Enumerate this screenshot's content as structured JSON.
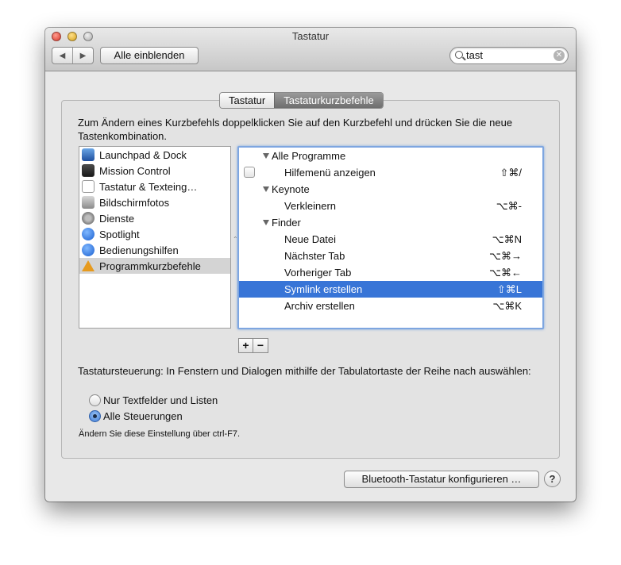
{
  "window": {
    "title": "Tastatur"
  },
  "toolbar": {
    "back_icon": "◀",
    "forward_icon": "▶",
    "show_all": "Alle einblenden",
    "search_value": "tast",
    "clear_icon": "✕"
  },
  "tabs": [
    {
      "label": "Tastatur",
      "active": false
    },
    {
      "label": "Tastaturkurzbefehle",
      "active": true
    }
  ],
  "intro": "Zum Ändern eines Kurzbefehls doppelklicken Sie auf den Kurzbefehl und drücken Sie die neue Tastenkombination.",
  "categories": [
    {
      "label": "Launchpad & Dock",
      "icon": "launchpad-icon"
    },
    {
      "label": "Mission Control",
      "icon": "mission-control-icon"
    },
    {
      "label": "Tastatur & Texteing…",
      "icon": "keyboard-icon"
    },
    {
      "label": "Bildschirmfotos",
      "icon": "screenshot-icon"
    },
    {
      "label": "Dienste",
      "icon": "services-gear-icon"
    },
    {
      "label": "Spotlight",
      "icon": "spotlight-icon"
    },
    {
      "label": "Bedienungshilfen",
      "icon": "accessibility-icon"
    },
    {
      "label": "Programmkurzbefehle",
      "icon": "app-shortcuts-icon",
      "selected": true
    }
  ],
  "shortcuts": [
    {
      "type": "group",
      "label": "Alle Programme"
    },
    {
      "type": "item",
      "label": "Hilfemenü anzeigen",
      "key": "⇧⌘/",
      "checkbox": true
    },
    {
      "type": "group",
      "label": "Keynote"
    },
    {
      "type": "item",
      "label": "Verkleinern",
      "key": "⌥⌘-"
    },
    {
      "type": "group",
      "label": "Finder"
    },
    {
      "type": "item",
      "label": "Neue Datei",
      "key": "⌥⌘N"
    },
    {
      "type": "item",
      "label": "Nächster Tab",
      "key": "⌥⌘→"
    },
    {
      "type": "item",
      "label": "Vorheriger Tab",
      "key": "⌥⌘←"
    },
    {
      "type": "item",
      "label": "Symlink erstellen",
      "key": "⇧⌘L",
      "selected": true
    },
    {
      "type": "item",
      "label": "Archiv erstellen",
      "key": "⌥⌘K"
    }
  ],
  "buttons": {
    "add": "+",
    "remove": "−"
  },
  "keyboard_control": {
    "text": "Tastatursteuerung: In Fenstern und Dialogen mithilfe der Tabulatortaste der Reihe nach auswählen:",
    "option_text_fields": "Nur Textfelder und Listen",
    "option_all_controls": "Alle Steuerungen",
    "selected": "Alle Steuerungen",
    "hint": "Ändern Sie diese Einstellung über ctrl-F7."
  },
  "footer": {
    "bluetooth": "Bluetooth-Tastatur konfigurieren …",
    "help": "?"
  }
}
